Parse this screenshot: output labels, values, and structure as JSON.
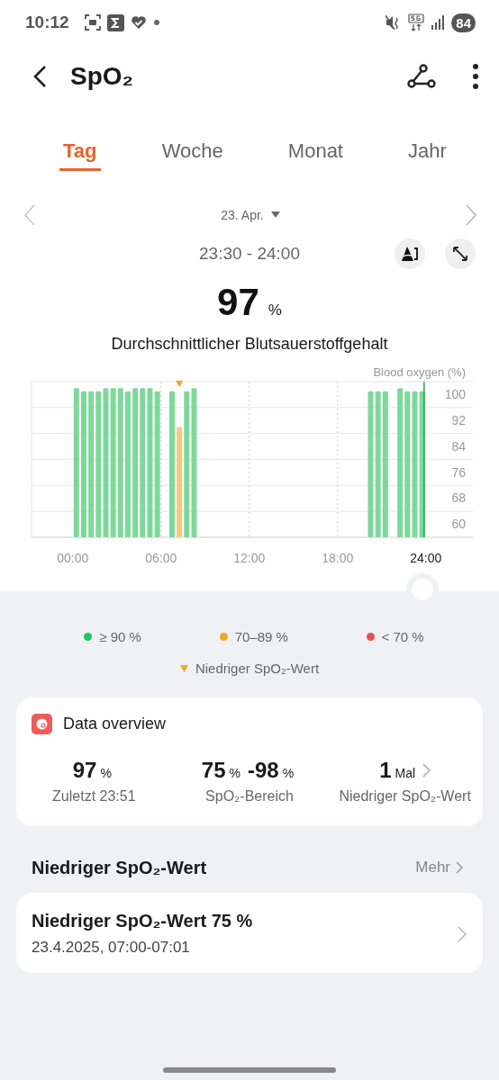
{
  "status_bar": {
    "time": "10:12",
    "battery": "84"
  },
  "app_bar": {
    "title": "SpO₂"
  },
  "tabs": [
    {
      "label": "Tag",
      "selected": true
    },
    {
      "label": "Woche",
      "selected": false
    },
    {
      "label": "Monat",
      "selected": false
    },
    {
      "label": "Jahr",
      "selected": false
    }
  ],
  "date_nav": {
    "date": "23. Apr."
  },
  "reading": {
    "time_range": "23:30 - 24:00",
    "value": "97",
    "unit": "%",
    "caption": "Durchschnittlicher Blutsauerstoffgehalt"
  },
  "chart": {
    "chart_data": {
      "type": "bar",
      "ylabel": "Blood oxygen (%)",
      "x": [
        0.25,
        0.75,
        1.25,
        1.75,
        2.25,
        2.75,
        3.25,
        3.75,
        4.25,
        4.75,
        5.25,
        5.75,
        6.75,
        7.25,
        7.75,
        8.25,
        20.25,
        20.75,
        21.25,
        22.25,
        22.75,
        23.25,
        23.75
      ],
      "grid": true,
      "values": [
        98,
        97,
        97,
        97,
        98,
        98,
        98,
        97,
        98,
        98,
        98,
        97,
        97,
        86,
        97,
        98,
        97,
        97,
        97,
        98,
        97,
        97,
        97
      ],
      "xlim": [
        -2.8,
        27.2
      ],
      "ylim": [
        52,
        100
      ],
      "xticks": [
        {
          "value": 0,
          "label": "00:00"
        },
        {
          "value": 6,
          "label": "06:00"
        },
        {
          "value": 12,
          "label": "12:00"
        },
        {
          "value": 18,
          "label": "18:00"
        },
        {
          "value": 24,
          "label": "24:00"
        }
      ],
      "yticks": [
        60,
        68,
        76,
        84,
        92,
        100
      ]
    },
    "bars": [
      {
        "color": "#7dd89a",
        "selected": false,
        "low_marker": false
      },
      {
        "color": "#7dd89a",
        "selected": false,
        "low_marker": false
      },
      {
        "color": "#7dd89a",
        "selected": false,
        "low_marker": false
      },
      {
        "color": "#7dd89a",
        "selected": false,
        "low_marker": false
      },
      {
        "color": "#7dd89a",
        "selected": false,
        "low_marker": false
      },
      {
        "color": "#7dd89a",
        "selected": false,
        "low_marker": false
      },
      {
        "color": "#7dd89a",
        "selected": false,
        "low_marker": false
      },
      {
        "color": "#7dd89a",
        "selected": false,
        "low_marker": false
      },
      {
        "color": "#7dd89a",
        "selected": false,
        "low_marker": false
      },
      {
        "color": "#7dd89a",
        "selected": false,
        "low_marker": false
      },
      {
        "color": "#7dd89a",
        "selected": false,
        "low_marker": false
      },
      {
        "color": "#7dd89a",
        "selected": false,
        "low_marker": false
      },
      {
        "color": "#7dd89a",
        "selected": false,
        "low_marker": false
      },
      {
        "color": "#fcc77b",
        "selected": false,
        "low_marker": true
      },
      {
        "color": "#7dd89a",
        "selected": false,
        "low_marker": false
      },
      {
        "color": "#7dd89a",
        "selected": false,
        "low_marker": false
      },
      {
        "color": "#7dd89a",
        "selected": false,
        "low_marker": false
      },
      {
        "color": "#7dd89a",
        "selected": false,
        "low_marker": false
      },
      {
        "color": "#7dd89a",
        "selected": false,
        "low_marker": false
      },
      {
        "color": "#7dd89a",
        "selected": false,
        "low_marker": false
      },
      {
        "color": "#7dd89a",
        "selected": false,
        "low_marker": false
      },
      {
        "color": "#7dd89a",
        "selected": false,
        "low_marker": false
      },
      {
        "color": "#7dd89a",
        "selected": true,
        "low_marker": false
      }
    ]
  },
  "legend": {
    "items": [
      {
        "label": "≥ 90 %",
        "color": "#22c55e"
      },
      {
        "label": "70–89 %",
        "color": "#f5a623"
      },
      {
        "label": "< 70 %",
        "color": "#e95050"
      }
    ],
    "low_marker_label": "Niedriger SpO₂-Wert"
  },
  "overview": {
    "title": "Data overview",
    "stats": [
      {
        "parts": [
          {
            "text": "97",
            "kind": "number"
          },
          {
            "text": "%",
            "kind": "unit"
          }
        ],
        "label": "Zuletzt 23:51",
        "link": false
      },
      {
        "parts": [
          {
            "text": "75",
            "kind": "number"
          },
          {
            "text": "%",
            "kind": "unit"
          },
          {
            "text": "-98",
            "kind": "number"
          },
          {
            "text": "%",
            "kind": "unit"
          }
        ],
        "label": "SpO₂-Bereich",
        "link": false
      },
      {
        "parts": [
          {
            "text": "1",
            "kind": "number"
          },
          {
            "text": "Mal",
            "kind": "unit"
          }
        ],
        "label": "Niedriger SpO₂-Wert",
        "link": true
      }
    ]
  },
  "low_section": {
    "title": "Niedriger SpO₂-Wert",
    "more": "Mehr"
  },
  "events": [
    {
      "title": "Niedriger SpO₂-Wert 75 %",
      "subtitle": "23.4.2025, 07:00-07:01"
    }
  ]
}
